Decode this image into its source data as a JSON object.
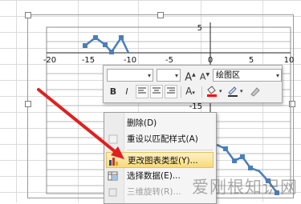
{
  "chart": {
    "x_ticks": [
      "-20",
      "-15",
      "-10",
      "-5",
      "0",
      "5",
      "10"
    ],
    "y_ticks": [
      "5",
      "-5",
      "-10",
      "-15"
    ],
    "series_color": "#4a7ebb"
  },
  "mini_toolbar": {
    "font_name": "",
    "font_size": "",
    "grow_font": "A",
    "shrink_font": "A",
    "element_name": "绘图区",
    "bold": "B",
    "italic": "I",
    "font_color_letter": "A"
  },
  "context_menu": {
    "items": [
      {
        "label": "删除(D)",
        "icon": "delete-icon",
        "enabled": true
      },
      {
        "label": "重设以匹配样式(A)",
        "icon": "reset-style-icon",
        "enabled": true
      },
      {
        "label": "更改图表类型(Y)...",
        "icon": "chart-type-icon",
        "enabled": true,
        "highlighted": true
      },
      {
        "label": "选择数据(E)...",
        "icon": "select-data-icon",
        "enabled": true
      },
      {
        "label": "三维旋转(R)...",
        "icon": "rotate-3d-icon",
        "enabled": false
      }
    ]
  },
  "arrow_color": "#e02020",
  "watermark": "爱刚根知识网"
}
